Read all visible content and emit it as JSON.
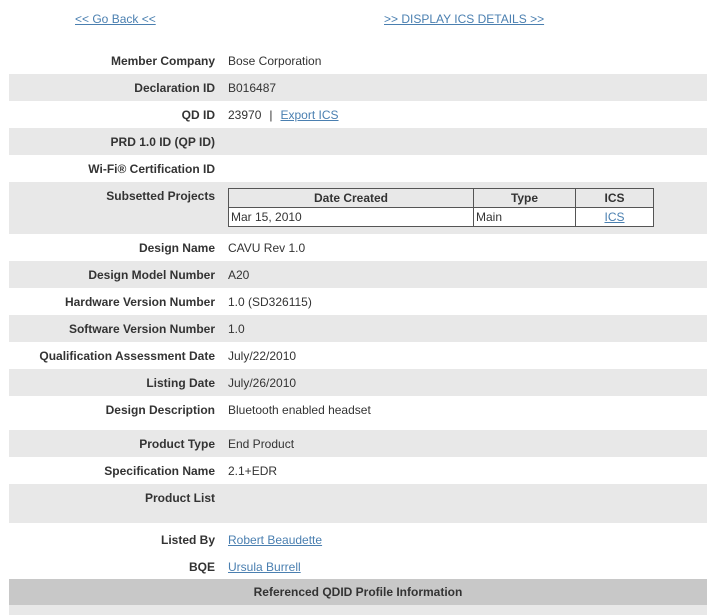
{
  "nav": {
    "go_back": "<< Go Back <<",
    "display_ics": ">> DISPLAY ICS DETAILS >>"
  },
  "fields": {
    "member_company": {
      "label": "Member Company",
      "value": "Bose Corporation"
    },
    "declaration_id": {
      "label": "Declaration ID",
      "value": "B016487"
    },
    "qd_id": {
      "label": "QD ID",
      "value": "23970",
      "separator": "|",
      "export_link": "Export ICS"
    },
    "prd_id": {
      "label": "PRD 1.0 ID (QP ID)",
      "value": ""
    },
    "wifi_cert": {
      "label": "Wi-Fi® Certification ID",
      "value": ""
    },
    "subsetted": {
      "label": "Subsetted Projects"
    },
    "design_name": {
      "label": "Design Name",
      "value": "CAVU Rev 1.0"
    },
    "design_model": {
      "label": "Design Model Number",
      "value": "A20"
    },
    "hardware_version": {
      "label": "Hardware Version Number",
      "value": "1.0 (SD326115)"
    },
    "software_version": {
      "label": "Software Version Number",
      "value": "1.0"
    },
    "qualification_date": {
      "label": "Qualification Assessment Date",
      "value": "July/22/2010"
    },
    "listing_date": {
      "label": "Listing Date",
      "value": "July/26/2010"
    },
    "design_description": {
      "label": "Design Description",
      "value": "Bluetooth enabled headset"
    },
    "product_type": {
      "label": "Product Type",
      "value": "End Product"
    },
    "spec_name": {
      "label": "Specification Name",
      "value": "2.1+EDR"
    },
    "product_list": {
      "label": "Product List",
      "value": ""
    },
    "listed_by": {
      "label": "Listed By",
      "value": "Robert Beaudette"
    },
    "bqe": {
      "label": "BQE",
      "value": "Ursula Burrell"
    }
  },
  "subsetted_table": {
    "headers": [
      "Date Created",
      "Type",
      "ICS"
    ],
    "rows": [
      {
        "date": "Mar 15, 2010",
        "type": "Main",
        "ics": "ICS"
      }
    ]
  },
  "referenced_header": "Referenced QDID Profile Information"
}
